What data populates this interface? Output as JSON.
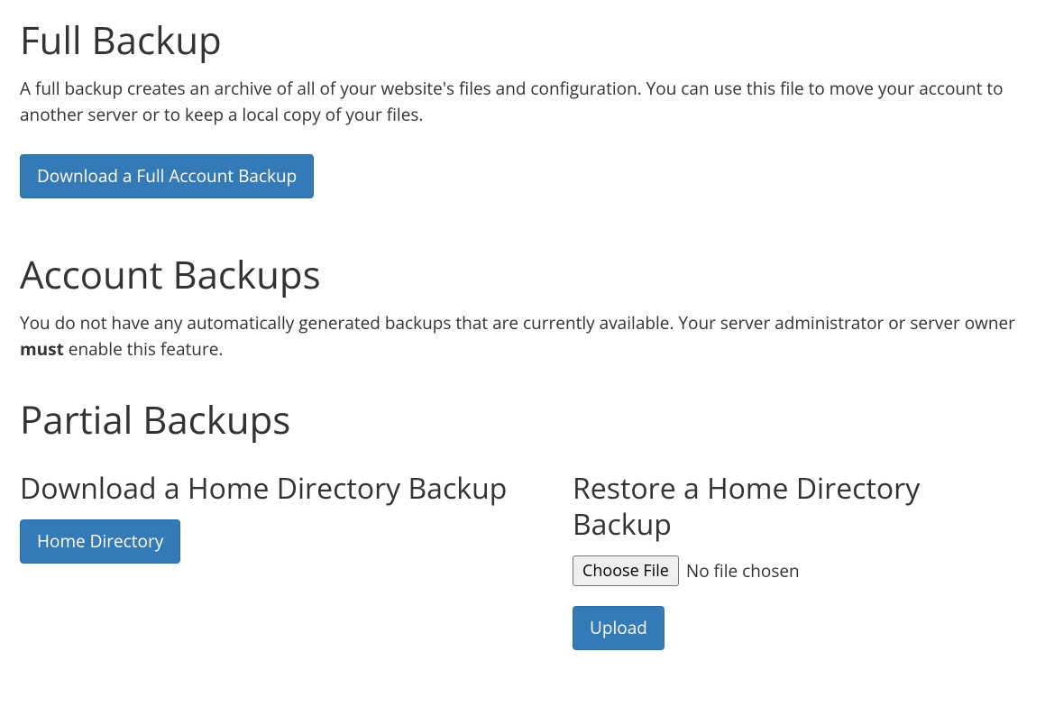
{
  "full_backup": {
    "heading": "Full Backup",
    "description": "A full backup creates an archive of all of your website's files and configuration. You can use this file to move your account to another server or to keep a local copy of your files.",
    "download_button": "Download a Full Account Backup"
  },
  "account_backups": {
    "heading": "Account Backups",
    "description_pre": "You do not have any automatically generated backups that are currently available. Your server administrator or server owner ",
    "description_strong": "must",
    "description_post": " enable this feature."
  },
  "partial_backups": {
    "heading": "Partial Backups",
    "download": {
      "heading": "Download a Home Directory Backup",
      "button": "Home Directory"
    },
    "restore": {
      "heading": "Restore a Home Directory Backup",
      "choose_file_label": "Choose File",
      "file_status": "No file chosen",
      "upload_button": "Upload"
    }
  }
}
